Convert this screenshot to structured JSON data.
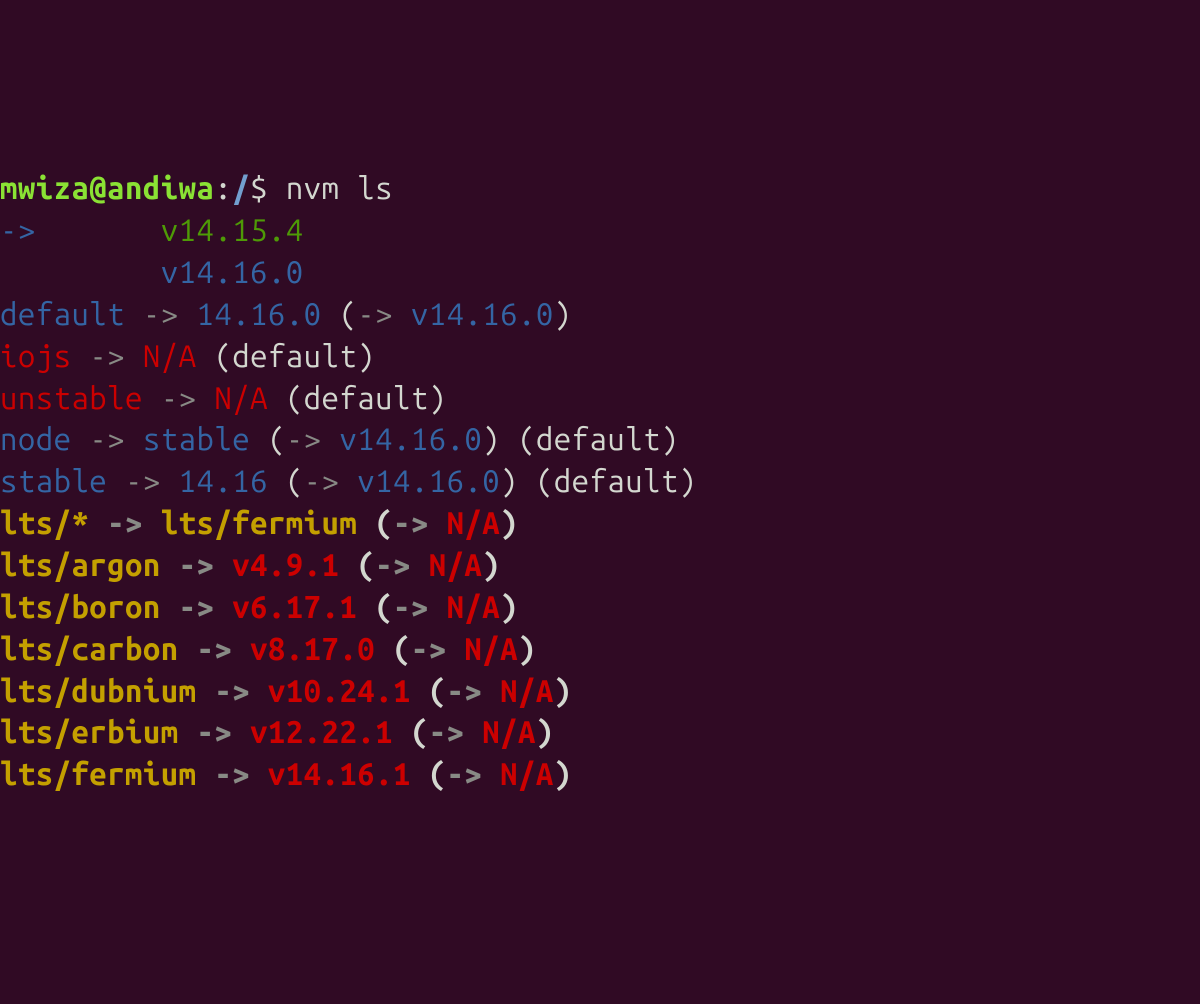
{
  "prompt": {
    "user_host": "mwiza@andiwa",
    "separator": ":",
    "path": "/",
    "dollar": "$ ",
    "command": "nvm ls"
  },
  "lines": {
    "line1_arrow": "->",
    "line1_spaces": "       ",
    "line1_version": "v14.15.4",
    "line2_spaces": "         ",
    "line2_version": "v14.16.0",
    "line3_alias": "default",
    "line3_arrow": " -> ",
    "line3_target": "14.16.0",
    "line3_paren_open": " (",
    "line3_inner_arrow": "-> ",
    "line3_inner_target": "v14.16.0",
    "line3_paren_close": ")",
    "line4_alias": "iojs",
    "line4_arrow": " -> ",
    "line4_target": "N/A",
    "line4_suffix": " (default)",
    "line5_alias": "unstable",
    "line5_arrow": " -> ",
    "line5_target": "N/A",
    "line5_suffix": " (default)",
    "line6_alias": "node",
    "line6_arrow": " -> ",
    "line6_target": "stable",
    "line6_paren_open": " (",
    "line6_inner_arrow": "-> ",
    "line6_inner_target": "v14.16.0",
    "line6_paren_close": ")",
    "line6_suffix": " (default)",
    "line7_alias": "stable",
    "line7_arrow": " -> ",
    "line7_target": "14.16",
    "line7_paren_open": " (",
    "line7_inner_arrow": "-> ",
    "line7_inner_target": "v14.16.0",
    "line7_paren_close": ")",
    "line7_suffix": " (default)",
    "line8_alias": "lts/*",
    "line8_arrow": " -> ",
    "line8_target": "lts/fermium",
    "line8_paren_open": " (",
    "line8_inner_arrow": "-> ",
    "line8_inner_target": "N/A",
    "line8_paren_close": ")",
    "line9_alias": "lts/argon",
    "line9_arrow": " -> ",
    "line9_target": "v4.9.1",
    "line9_paren_open": " (",
    "line9_inner_arrow": "-> ",
    "line9_inner_target": "N/A",
    "line9_paren_close": ")",
    "line10_alias": "lts/boron",
    "line10_arrow": " -> ",
    "line10_target": "v6.17.1",
    "line10_paren_open": " (",
    "line10_inner_arrow": "-> ",
    "line10_inner_target": "N/A",
    "line10_paren_close": ")",
    "line11_alias": "lts/carbon",
    "line11_arrow": " -> ",
    "line11_target": "v8.17.0",
    "line11_paren_open": " (",
    "line11_inner_arrow": "-> ",
    "line11_inner_target": "N/A",
    "line11_paren_close": ")",
    "line12_alias": "lts/dubnium",
    "line12_arrow": " -> ",
    "line12_target": "v10.24.1",
    "line12_paren_open": " (",
    "line12_inner_arrow": "-> ",
    "line12_inner_target": "N/A",
    "line12_paren_close": ")",
    "line13_alias": "lts/erbium",
    "line13_arrow": " -> ",
    "line13_target": "v12.22.1",
    "line13_paren_open": " (",
    "line13_inner_arrow": "-> ",
    "line13_inner_target": "N/A",
    "line13_paren_close": ")",
    "line14_alias": "lts/fermium",
    "line14_arrow": " -> ",
    "line14_target": "v14.16.1",
    "line14_paren_open": " (",
    "line14_inner_arrow": "-> ",
    "line14_inner_target": "N/A",
    "line14_paren_close": ")"
  }
}
